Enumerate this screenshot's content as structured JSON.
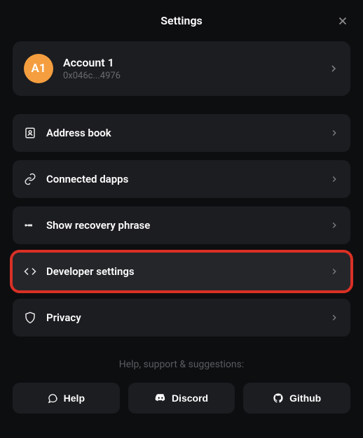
{
  "header": {
    "title": "Settings"
  },
  "account": {
    "avatar_label": "A1",
    "name": "Account 1",
    "address": "0x046c...4976"
  },
  "items": [
    {
      "icon": "address-book-icon",
      "label": "Address book"
    },
    {
      "icon": "link-icon",
      "label": "Connected dapps"
    },
    {
      "icon": "key-icon",
      "label": "Show recovery phrase"
    },
    {
      "icon": "code-icon",
      "label": "Developer settings",
      "highlighted": true
    },
    {
      "icon": "shield-icon",
      "label": "Privacy"
    }
  ],
  "footer": {
    "caption": "Help, support & suggestions:",
    "buttons": [
      {
        "icon": "chat-icon",
        "label": "Help"
      },
      {
        "icon": "discord-icon",
        "label": "Discord"
      },
      {
        "icon": "github-icon",
        "label": "Github"
      }
    ]
  }
}
